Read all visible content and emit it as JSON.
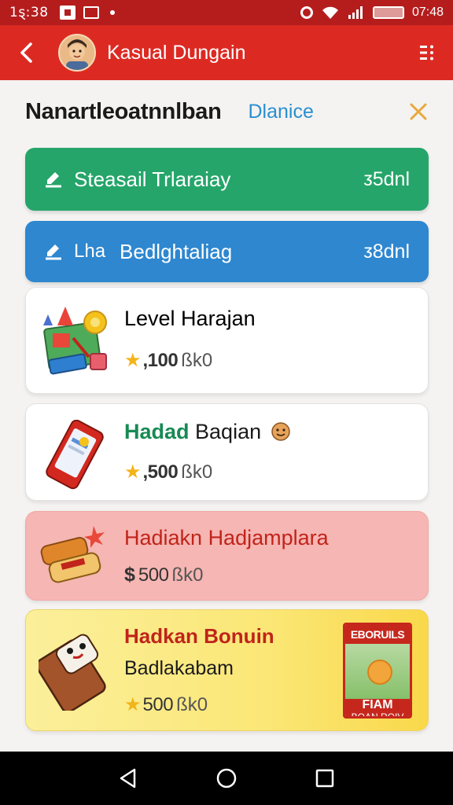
{
  "status_bar": {
    "time_left": "1ȿ:38",
    "time_right": "07:48"
  },
  "app_bar": {
    "title": "Kasual Dungain"
  },
  "header": {
    "title": "Nanartleoatnnlban",
    "balance_link": "Dlanice"
  },
  "banners": [
    {
      "label": "Steasail Trlaraiay",
      "prefix": "",
      "amount": "ᴣ5dnl",
      "color": "#25a56a"
    },
    {
      "label": "Bedlghtaliag",
      "prefix": "Lha",
      "amount": "ᴣ8dnl",
      "color": "#2e87cf"
    }
  ],
  "cards": [
    {
      "title": "Level Harajan",
      "subtitle": "",
      "price_symbol": "★",
      "price": ",100",
      "unit": "ßk0",
      "title_color": "#1a1a1a"
    },
    {
      "title": "Hadad",
      "title_rest": " Baqian",
      "subtitle": "",
      "price_symbol": "★",
      "price": ",500",
      "unit": "ßk0",
      "title_color": "#178a54"
    },
    {
      "title": "Hadiakn Hadjamplara",
      "subtitle": "",
      "price_symbol": "$",
      "price": "500",
      "unit": "ßk0",
      "title_color": "#c0241b"
    },
    {
      "title": "Hadkan Bonuin",
      "subtitle": "Badlakabam",
      "price_symbol": "★",
      "price": "500",
      "unit": "ßk0",
      "title_color": "#c0241b"
    }
  ],
  "promo": {
    "top": "EBORUILS",
    "bottom_big": "FIAM",
    "bottom_small": "BOAN ROIV"
  },
  "nav": {
    "back": "back",
    "home": "home",
    "recents": "recents"
  }
}
